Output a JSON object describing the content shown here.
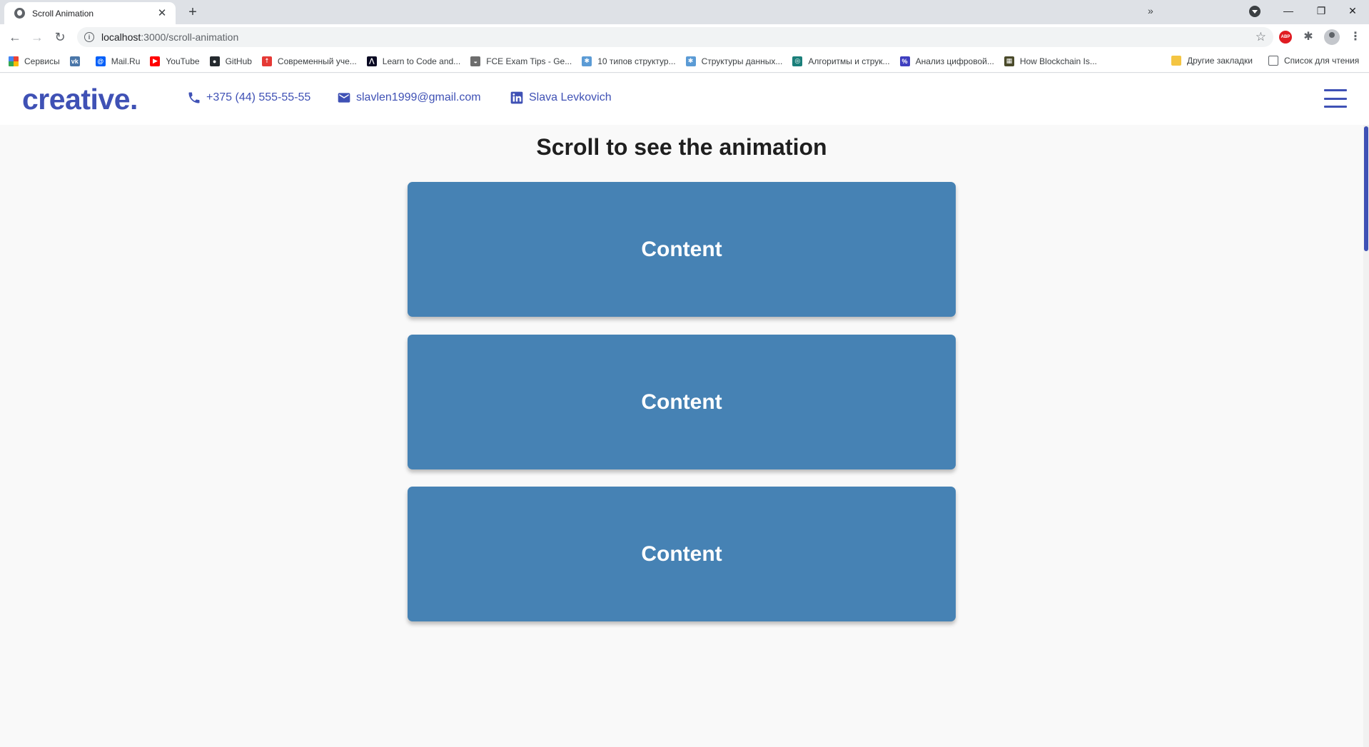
{
  "browser": {
    "tab": {
      "title": "Scroll Animation",
      "close": "✕"
    },
    "new_tab": "+",
    "window_controls": {
      "minimize": "—",
      "restore": "❐",
      "close": "✕"
    },
    "nav": {
      "back": "←",
      "forward": "→",
      "reload": "↻"
    },
    "address": {
      "host": "localhost",
      "path": ":3000/scroll-animation"
    },
    "star": "☆",
    "abp_label": "ABP",
    "puzzle": "✱",
    "menu": "⋮",
    "bookmarks": [
      {
        "label": "Сервисы",
        "icon": "apps-icon",
        "color": ""
      },
      {
        "label": "",
        "icon": "vk-icon",
        "color": "#4a76a8",
        "glyph": "vk"
      },
      {
        "label": "Mail.Ru",
        "icon": "mailru-icon",
        "color": "#005ff9",
        "glyph": "@"
      },
      {
        "label": "YouTube",
        "icon": "youtube-icon",
        "color": "#ff0000",
        "glyph": "▶"
      },
      {
        "label": "GitHub",
        "icon": "github-icon",
        "color": "#24292e",
        "glyph": "●"
      },
      {
        "label": "Современный уче...",
        "icon": "js-tutorial-icon",
        "color": "#e53935",
        "glyph": "☨"
      },
      {
        "label": "Learn to Code and...",
        "icon": "freecodecamp-icon",
        "color": "#0a0a23",
        "glyph": "⋀"
      },
      {
        "label": "FCE Exam Tips - Ge...",
        "icon": "fce-icon",
        "color": "#6d6d6d",
        "glyph": "◒"
      },
      {
        "label": "10 типов структур...",
        "icon": "habr-icon-1",
        "color": "#5b9bd5",
        "glyph": "✱"
      },
      {
        "label": "Структуры данных...",
        "icon": "habr-icon-2",
        "color": "#5b9bd5",
        "glyph": "✱"
      },
      {
        "label": "Алгоритмы и струк...",
        "icon": "algo-icon",
        "color": "#1a7f7a",
        "glyph": "◎"
      },
      {
        "label": "Анализ цифровой...",
        "icon": "analysis-icon",
        "color": "#3f3fbf",
        "glyph": "%"
      },
      {
        "label": "How Blockchain Is...",
        "icon": "blockchain-icon",
        "color": "#4a4a2a",
        "glyph": "▦"
      }
    ],
    "bookmarks_overflow": "»",
    "other_bookmarks": "Другие закладки",
    "reading_list": "Список для чтения"
  },
  "header": {
    "logo": "creative.",
    "phone": "+375 (44) 555-55-55",
    "email": "slavlen1999@gmail.com",
    "linkedin": "Slava Levkovich"
  },
  "main": {
    "heading": "Scroll to see the animation",
    "cards": [
      "Content",
      "Content",
      "Content"
    ]
  },
  "colors": {
    "brand": "#3f51b5",
    "card": "#4682b4",
    "page_bg": "#f9f9f9"
  }
}
